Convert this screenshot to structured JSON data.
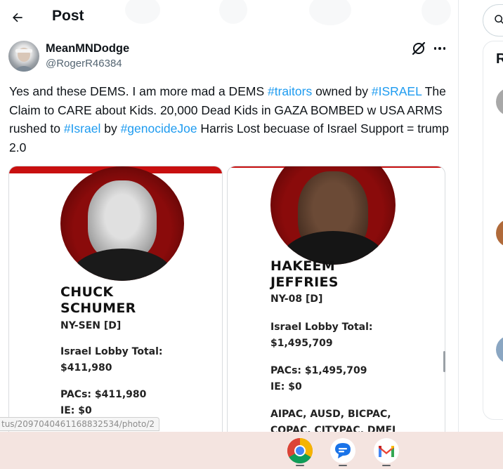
{
  "header": {
    "title": "Post"
  },
  "post": {
    "author_name": "MeanMNDodge",
    "author_handle": "@RogerR46384",
    "text_parts": [
      {
        "text": "Yes and these DEMS. I am more mad a DEMS ",
        "tag": false
      },
      {
        "text": "#traitors",
        "tag": true
      },
      {
        "text": " owned by ",
        "tag": false
      },
      {
        "text": "#ISRAEL",
        "tag": true
      },
      {
        "text": "  The Claim to CARE about Kids. 20,000 Dead Kids in GAZA BOMBED w USA ARMS rushed to ",
        "tag": false
      },
      {
        "text": "#Israel",
        "tag": true
      },
      {
        "text": " by ",
        "tag": false
      },
      {
        "text": "#genocideJoe",
        "tag": true
      },
      {
        "text": "  Harris Lost becuase of Israel Support  = trump 2.0",
        "tag": false
      }
    ]
  },
  "media": {
    "left": {
      "name_line1": "CHUCK",
      "name_line2": "SCHUMER",
      "district": "NY-SEN [D]",
      "lobby_label": "Israel Lobby Total:",
      "lobby_value": "$411,980",
      "pacs": "PACs: $411,980",
      "ie": "IE: $0"
    },
    "right": {
      "name_line1": "HAKEEM",
      "name_line2": "JEFFRIES",
      "district": "NY-08 [D]",
      "lobby_label": "Israel Lobby Total:",
      "lobby_value": "$1,495,709",
      "pacs": "PACs: $1,495,709",
      "ie": "IE: $0",
      "orgs_line1": "AIPAC, AUSD, BICPAC,",
      "orgs_line2": "COPAC, CITYPAC, DMFI"
    }
  },
  "status_bar": {
    "url": "tus/2097040461168832534/photo/2"
  },
  "sidebar": {
    "heading_initial": "R"
  },
  "taskbar": {
    "apps": [
      "chrome-icon",
      "messages-icon",
      "gmail-icon"
    ]
  },
  "colors": {
    "hashtag": "#1d9bf0",
    "card_red": "#c80f0f",
    "taskbar_bg": "#f4e4e0"
  }
}
